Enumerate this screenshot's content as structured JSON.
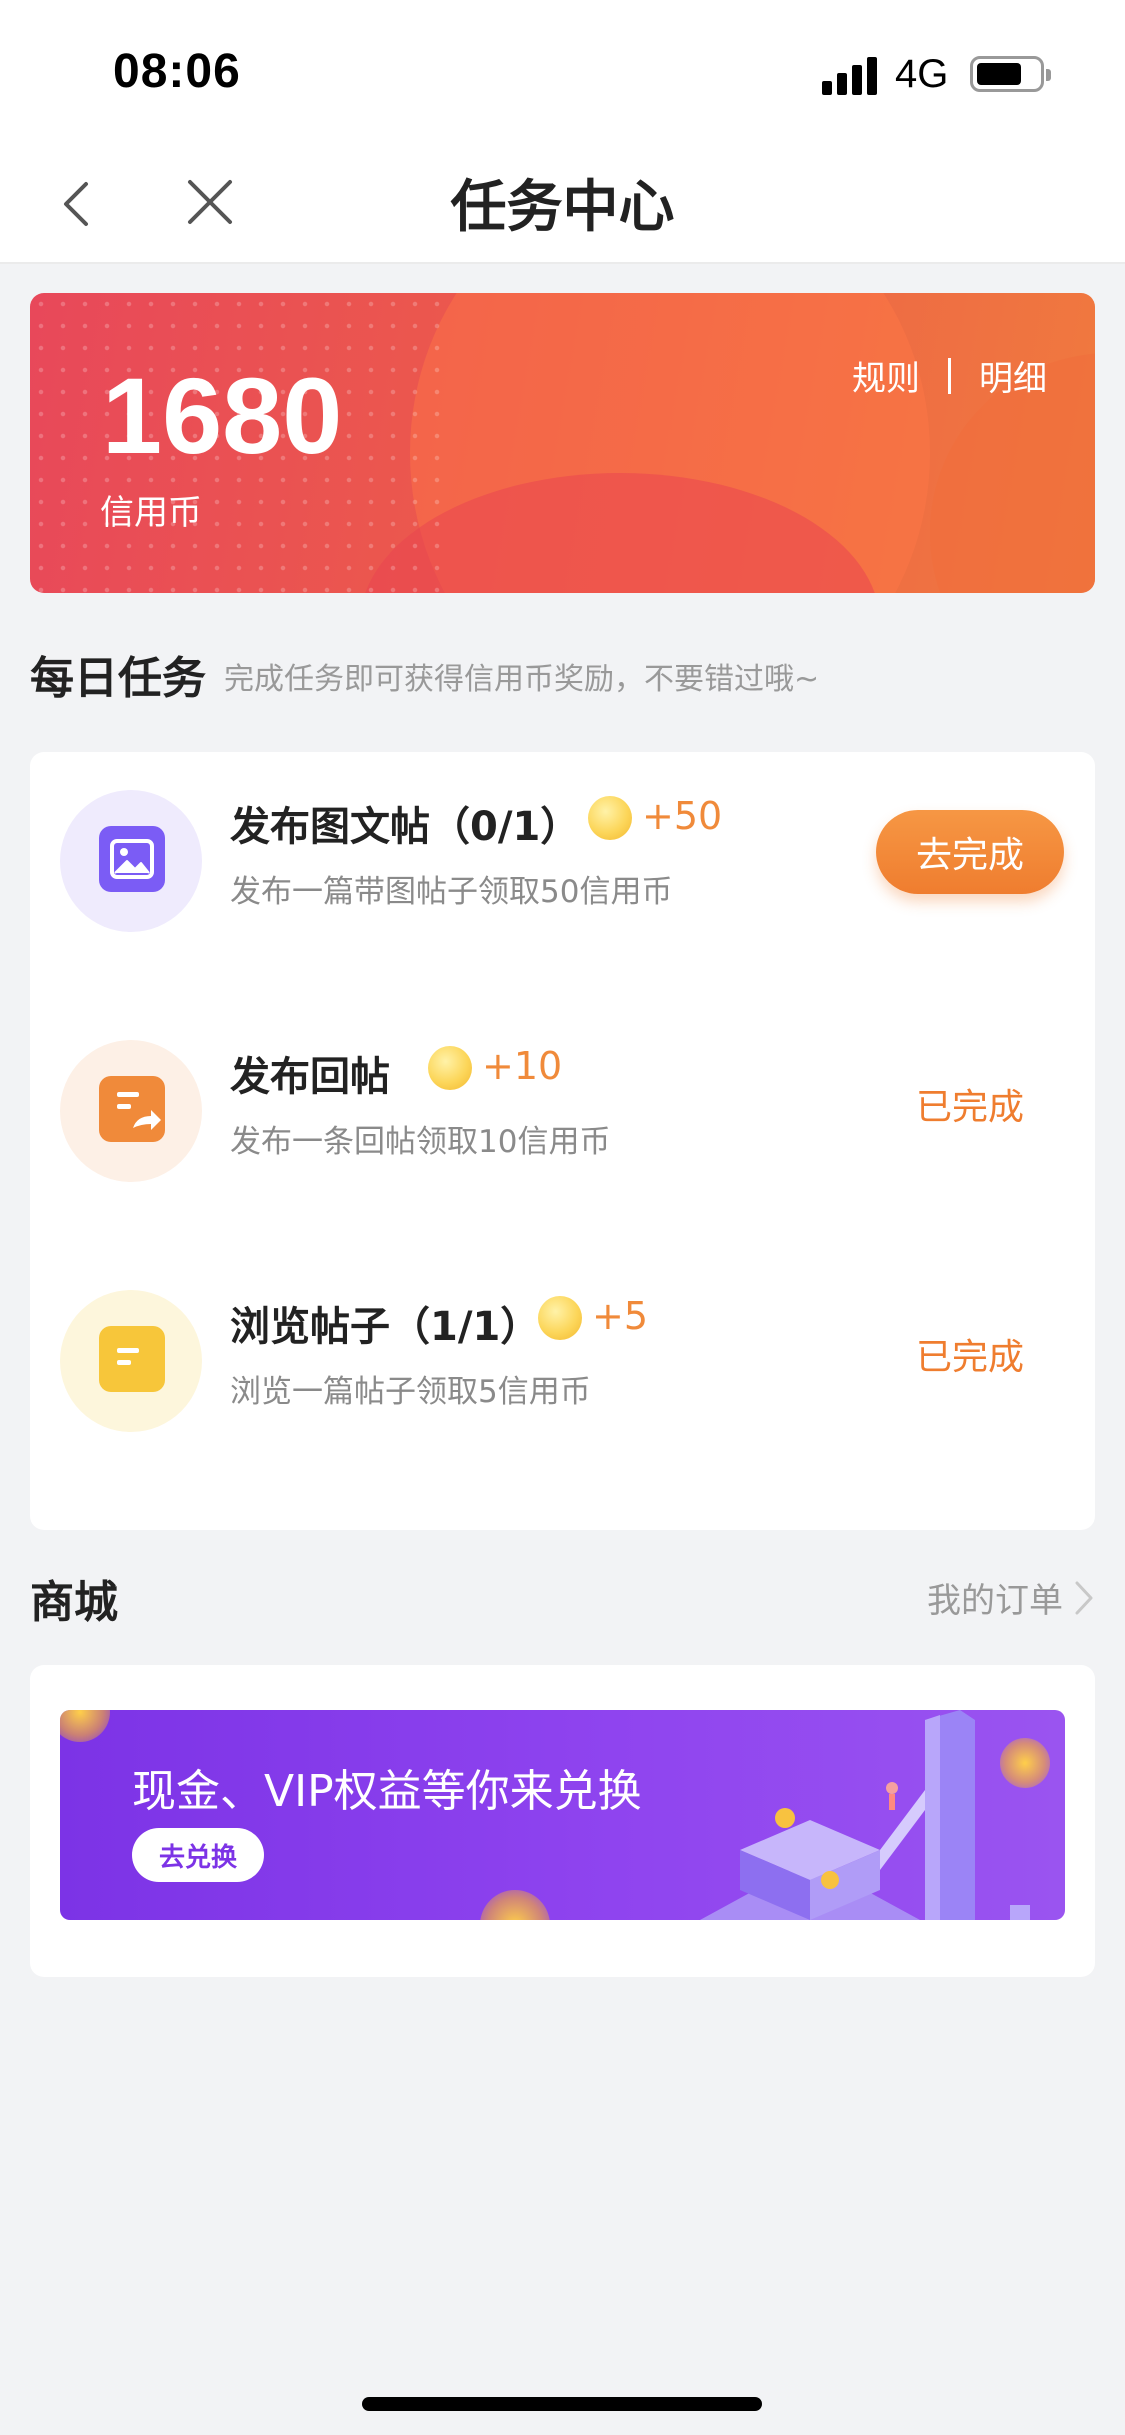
{
  "status": {
    "time": "08:06",
    "network": "4G"
  },
  "nav": {
    "title": "任务中心"
  },
  "banner": {
    "amount": "1680",
    "unit": "信用币",
    "rules": "规则",
    "details": "明细"
  },
  "daily": {
    "title": "每日任务",
    "subtitle": "完成任务即可获得信用币奖励，不要错过哦~",
    "tasks": [
      {
        "title": "发布图文帖（0/1）",
        "reward": "+50",
        "desc": "发布一篇带图帖子领取50信用币",
        "action": "去完成",
        "icon": "image-post-icon",
        "color": "#7b5cf5"
      },
      {
        "title": "发布回帖",
        "reward": "+10",
        "desc": "发布一条回帖领取10信用币",
        "action": "已完成",
        "icon": "reply-post-icon",
        "color": "#f08a3a"
      },
      {
        "title": "浏览帖子（1/1）",
        "reward": "+5",
        "desc": "浏览一篇帖子领取5信用币",
        "action": "已完成",
        "icon": "browse-post-icon",
        "color": "#f7c63a"
      }
    ]
  },
  "mall": {
    "title": "商城",
    "orders": "我的订单",
    "banner_text": "现金、VIP权益等你来兑换",
    "banner_button": "去兑换"
  }
}
